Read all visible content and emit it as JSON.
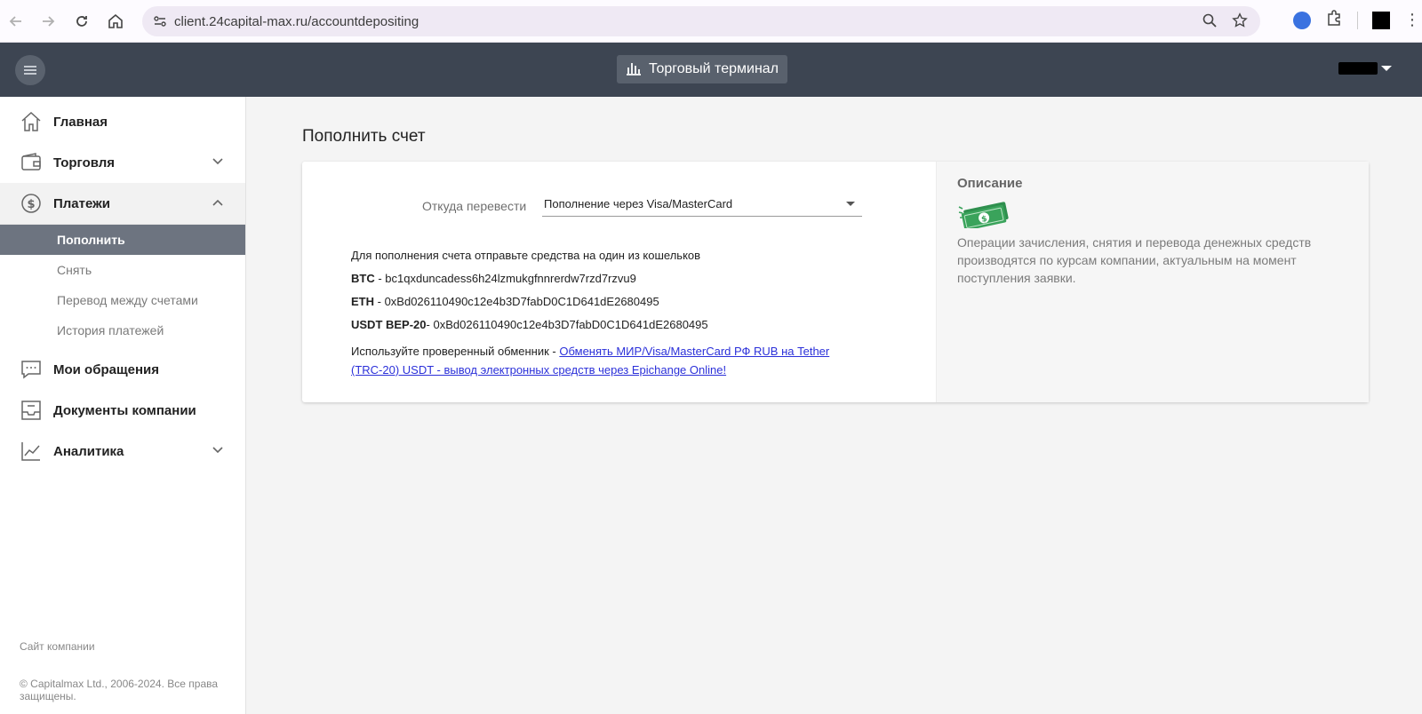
{
  "browser": {
    "url": "client.24capital-max.ru/accountdepositing"
  },
  "header": {
    "terminal_label": "Торговый терминал"
  },
  "sidebar": {
    "items": [
      {
        "label": "Главная"
      },
      {
        "label": "Торговля"
      },
      {
        "label": "Платежи"
      },
      {
        "label": "Мои обращения"
      },
      {
        "label": "Документы компании"
      },
      {
        "label": "Аналитика"
      }
    ],
    "payments_sub": [
      {
        "label": "Пополнить"
      },
      {
        "label": "Снять"
      },
      {
        "label": "Перевод между счетами"
      },
      {
        "label": "История платежей"
      }
    ],
    "company_site": "Сайт компании",
    "copyright": "© Capitalmax Ltd., 2006-2024. Все права защищены."
  },
  "main": {
    "title": "Пополнить счет",
    "from_label": "Откуда перевести",
    "from_value": "Пополнение через Visa/MasterCard",
    "intro": "Для пополнения счета отправьте средства на один из кошельков",
    "wallets": [
      {
        "name": "BTC",
        "sep": " - ",
        "address": "bc1qxduncadess6h24lzmukgfnnrerdw7rzd7rzvu9"
      },
      {
        "name": "ETH",
        "sep": " - ",
        "address": "0xBd026110490c12e4b3D7fabD0C1D641dE2680495"
      },
      {
        "name": "USDT BEP-20",
        "sep": "- ",
        "address": "0xBd026110490c12e4b3D7fabD0C1D641dE2680495"
      }
    ],
    "exchanger_prefix": "Используйте проверенный обменник - ",
    "exchanger_link": "Обменять МИР/Visa/MasterCard РФ RUB на Tether (TRC-20) USDT - вывод электронных средств через Epichange Online!"
  },
  "description": {
    "title": "Описание",
    "icon": "money-icon",
    "text": "Операции зачисления, снятия и перевода денежных средств производятся по курсам компании, актуальным на момент поступления заявки."
  },
  "colors": {
    "header_bg": "#3d4552",
    "active_sub_bg": "#6d7480",
    "link": "#2b30d9",
    "money_green": "#3aa35b"
  }
}
